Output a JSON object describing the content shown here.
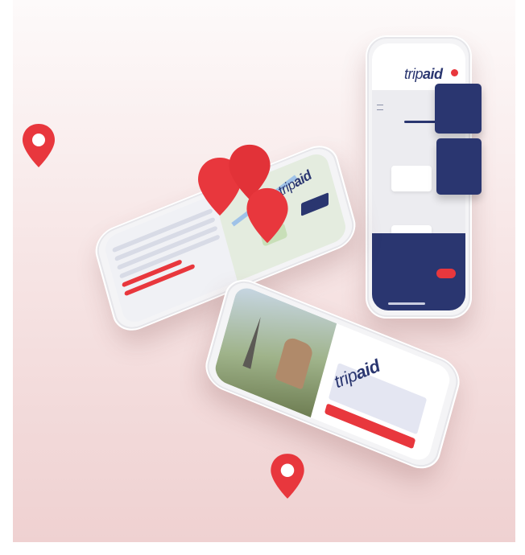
{
  "brand": {
    "logo_prefix": "trip",
    "logo_suffix": "aid"
  },
  "colors": {
    "accent_red": "#e8373d",
    "navy": "#2a3670",
    "background_top": "#fdfafa",
    "background_bottom": "#efd1d1"
  },
  "icons": [
    "map-pin-icon",
    "hamburger-menu-icon",
    "notification-badge-icon"
  ]
}
